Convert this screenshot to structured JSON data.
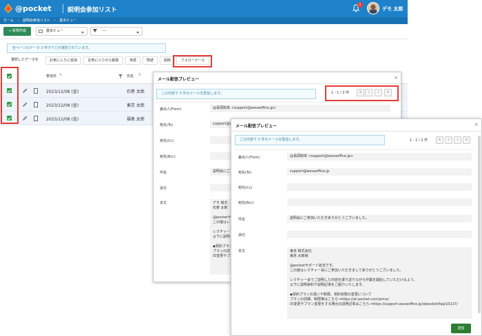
{
  "header": {
    "brand": "@pocket",
    "app_title": "説明会参加リスト",
    "notification_count": "1",
    "user_name": "デモ 太郎"
  },
  "breadcrumb": [
    "ホーム",
    "›",
    "説明会参加リスト",
    "›",
    "基本ビュー"
  ],
  "toolbar": {
    "new_label": "+ 新規作成",
    "view_label": "基本ビュー",
    "filter_label": "---"
  },
  "banner": "全ページのデータ 3 件すべてが選択されています。",
  "actions": [
    "選択したデータを",
    "お気に入りに追加",
    "お気に入りから削除",
    "未読",
    "既読",
    "削除",
    "フォローメール"
  ],
  "table": {
    "columns": [
      "参加日",
      "氏名"
    ],
    "rows": [
      {
        "date": "2023/12/08 (金)",
        "name": "石巻 太郎"
      },
      {
        "date": "2023/12/08 (金)",
        "name": "東京 太郎"
      },
      {
        "date": "2023/12/08 (金)",
        "name": "福島 太郎"
      }
    ]
  },
  "modal1": {
    "title": "メール配信プレビュー",
    "info": "この内容で 3 件のメールを配信します。",
    "pager": "1 - 1 / 3 件",
    "fields": [
      {
        "label": "差出人(From)",
        "value": "@長岡知栄 <support@wavaoffice.jp>"
      },
      {
        "label": "宛先(To)",
        "value": "support@wav"
      },
      {
        "label": "宛先(Cc)",
        "value": ""
      },
      {
        "label": "宛先(Bcc)",
        "value": ""
      },
      {
        "label": "件名",
        "value": "説明会にご"
      },
      {
        "label": "添付",
        "value": ""
      }
    ],
    "body_label": "本文",
    "body": "デモ 株式\n石巻 太郎\n\n@pocketサ\nこの度はレ\n\nレクチャー\n以下に説明\n\n◆契約プラン\nプランの詳\nID変更やブ"
  },
  "modal2": {
    "title": "メール配信プレビュー",
    "info": "この内容で 2 件のメールを配信します。",
    "pager": "1 - 1 / 2 件",
    "fields": [
      {
        "label": "差出人(From)",
        "value": "@長岡知栄 <support@wavaoffice.jp>"
      },
      {
        "label": "宛先(To)",
        "value": "support@wavaoffice.jp"
      },
      {
        "label": "宛先(Cc)",
        "value": ""
      },
      {
        "label": "宛先(Bcc)",
        "value": ""
      },
      {
        "label": "件名",
        "value": "説明会にご参加いただきありがとうございました。"
      },
      {
        "label": "添付",
        "value": ""
      }
    ],
    "body_label": "本文",
    "body": "東京 株式会社\n東京 太郎様\n\n@pocketサポート担当です。\nこの度はレクチャー会にご参加いただきましてありがとうございました。\n\nレクチャー会でご説明した内容を振り返りながら作業を開始していただけるよう、\n以下に説明資料や説明記事をご紹介いたします。\n\n◆契約プランの違いや制限、契約状態の変更について\nプランの詳細、制限等はこちら→https://at-pocket.com/price/\nID変更やプラン変更をする場合の説明記事はこちら→https://support.wavaoffice.jp/atpocket/faq/10117/",
    "send_label": "送信"
  }
}
